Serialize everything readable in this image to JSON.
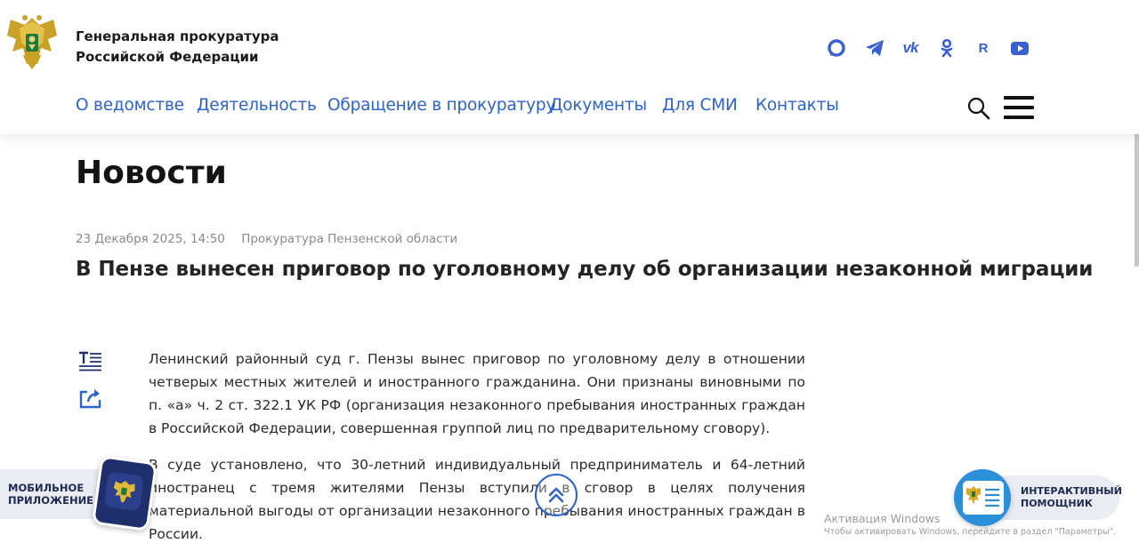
{
  "header": {
    "org_name_line1": "Генеральная прокуратура",
    "org_name_line2": "Российской Федерации",
    "social": [
      "max-icon",
      "telegram-icon",
      "vk-icon",
      "odnoklassniki-icon",
      "rutube-icon",
      "youtube-icon"
    ],
    "social_rutube_letter": "R",
    "social_vk_text": "vk",
    "nav": [
      "О ведомстве",
      "Деятельность",
      "Обращение в прокуратуру",
      "Документы",
      "Для СМИ",
      "Контакты"
    ],
    "accent_color": "#2e63c9"
  },
  "page": {
    "title": "Новости"
  },
  "article": {
    "date": "23 Декабря 2025, 14:50",
    "source": "Прокуратура Пензенской области",
    "title": "В Пензе вынесен приговор по уголовному делу об организации незаконной миграции",
    "paragraphs": [
      "Ленинский районный суд г. Пензы вынес приговор по уголовному делу в отношении четверых местных жителей и иностранного гражданина. Они признаны виновными по п. «а» ч. 2 ст. 322.1 УК РФ (организация незаконного пребывания иностранных граждан в Российской Федерации, совершенная группой лиц по предварительному сговору).",
      "В суде установлено, что 30-летний индивидуальный предприниматель и 64-летний иностранец с тремя жителями Пензы вступили в сговор в целях получения материальной выгоды от организации незаконного пребывания иностранных граждан в России."
    ]
  },
  "widgets": {
    "app_label_line1": "МОБИЛЬНОЕ",
    "app_label_line2": "ПРИЛОЖЕНИЕ",
    "assistant_label_line1": "ИНТЕРАКТИВНЫЙ",
    "assistant_label_line2": "ПОМОЩНИК"
  },
  "watermark": {
    "line1": "Активация Windows",
    "line2": "Чтобы активировать Windows, перейдите в раздел \"Параметры\"."
  }
}
